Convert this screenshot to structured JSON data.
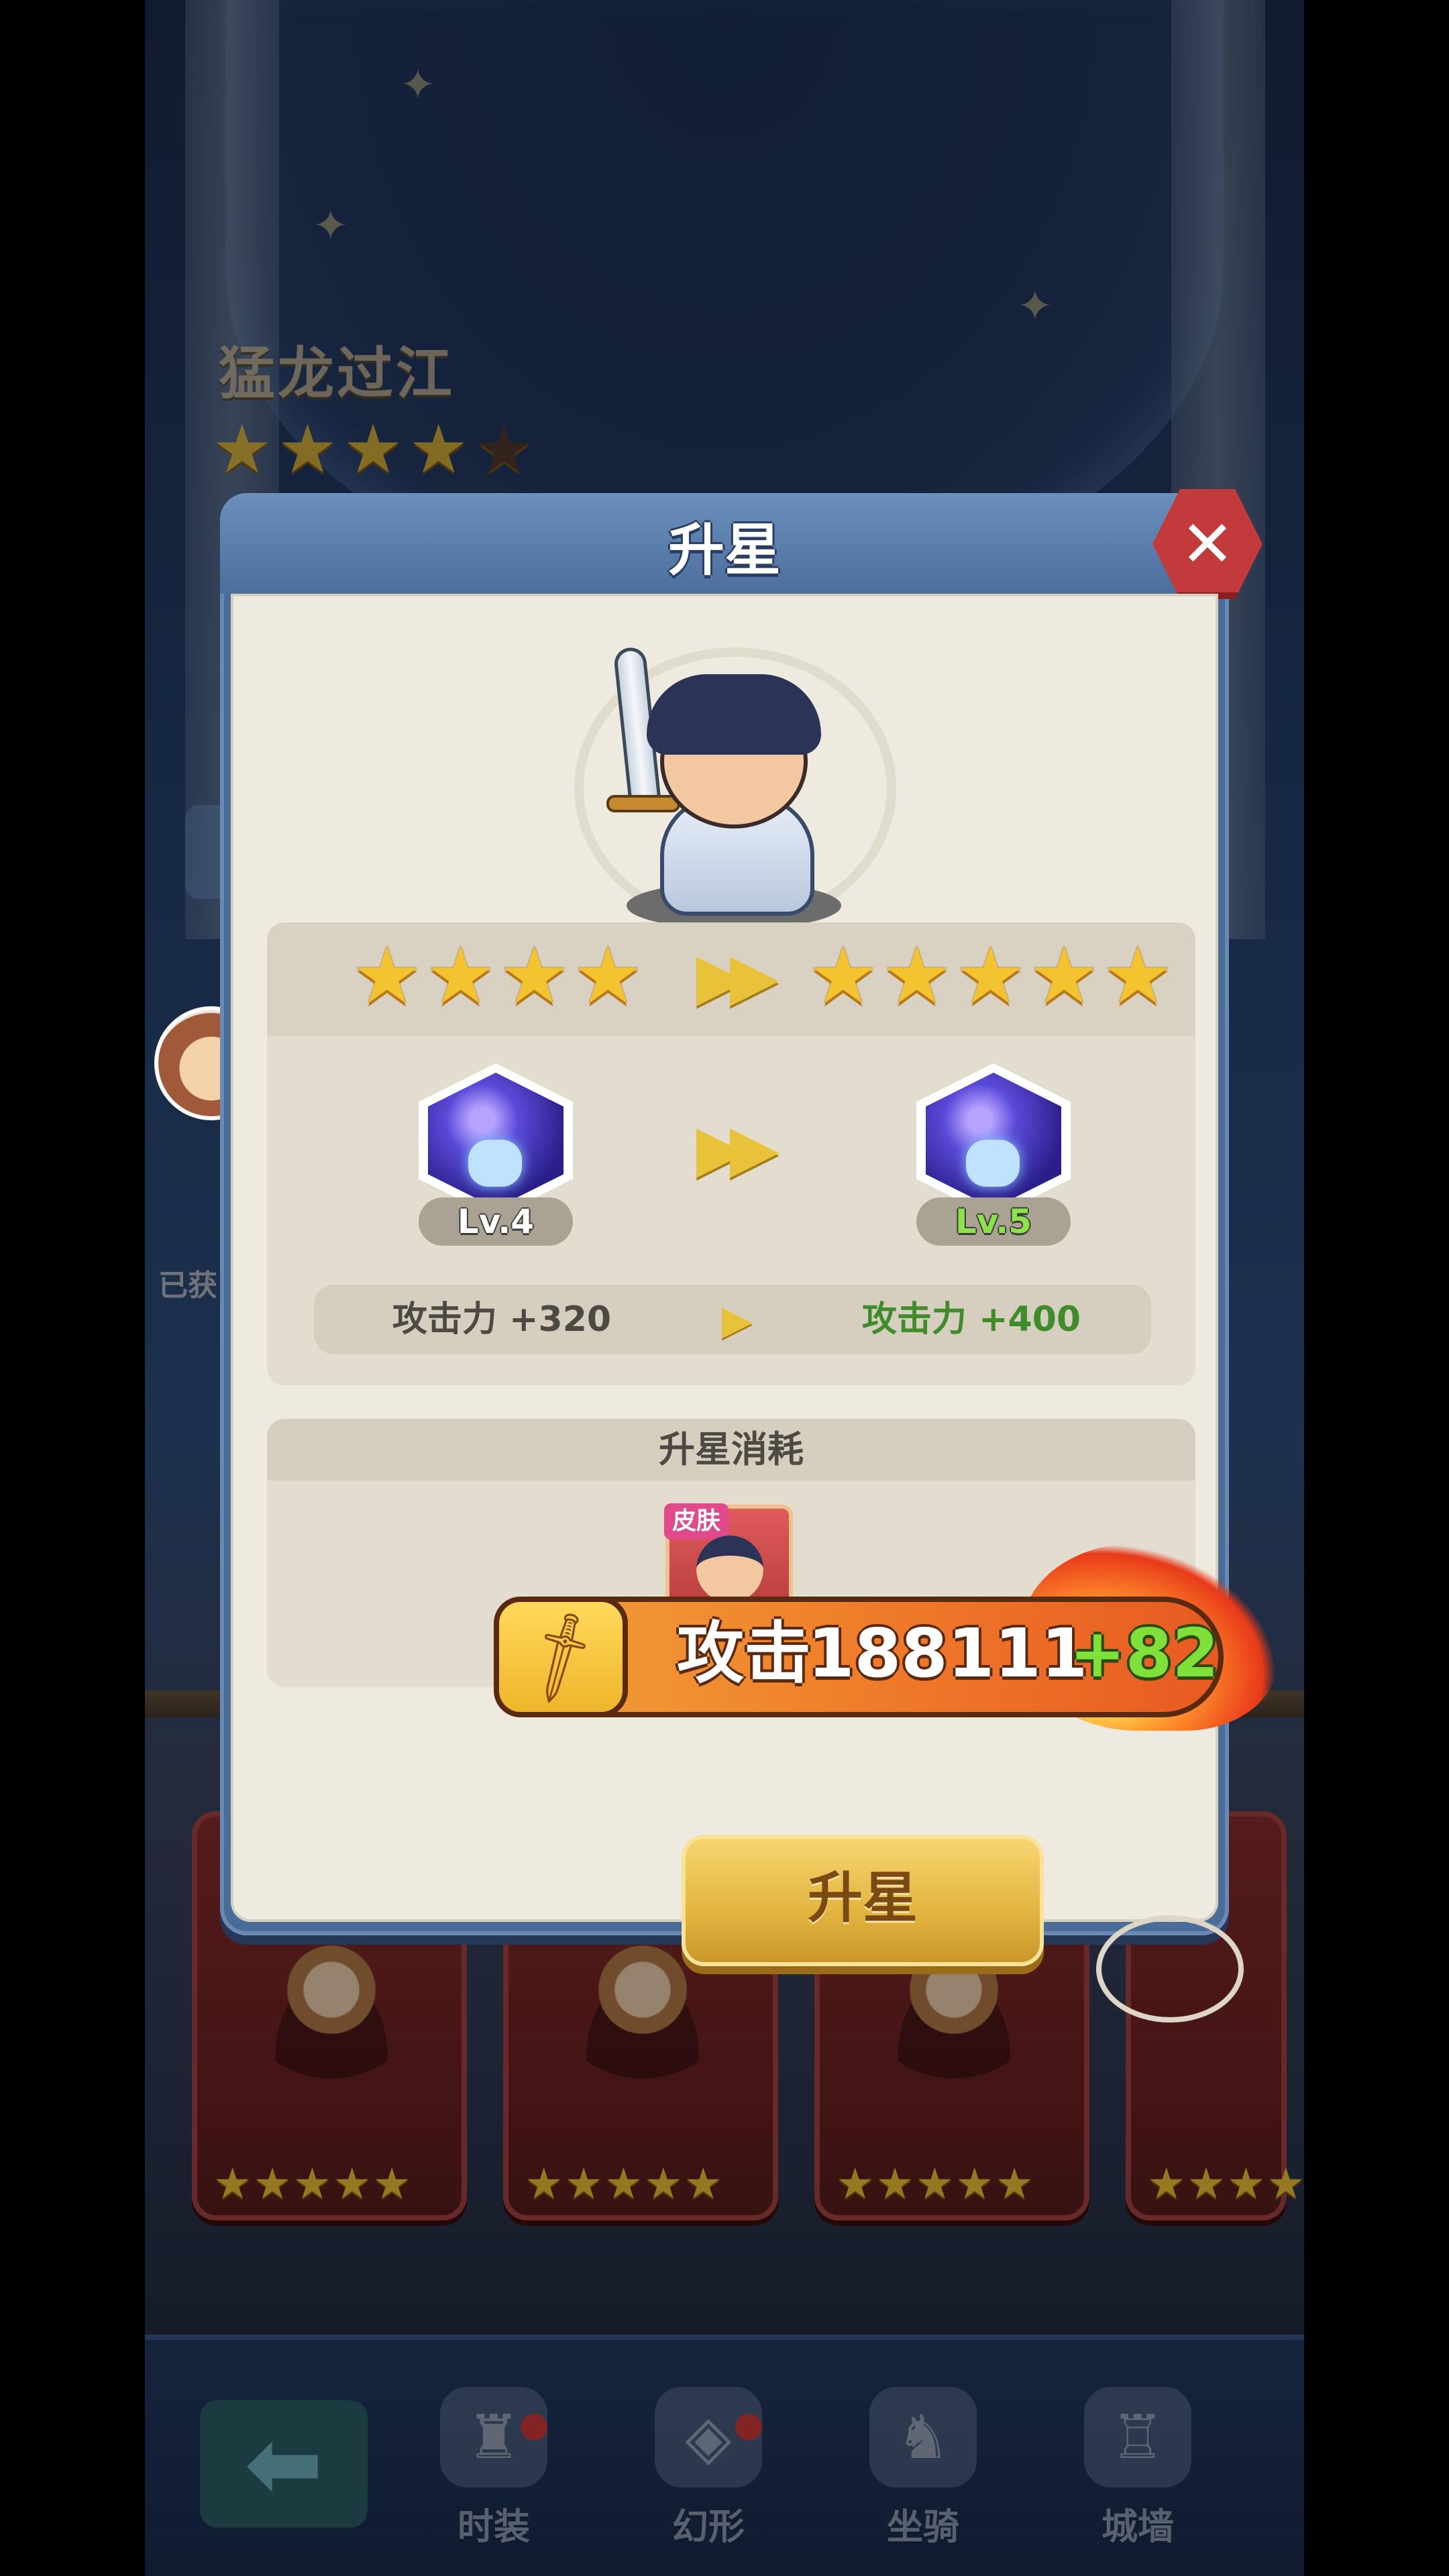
{
  "background": {
    "hero_name": "猛龙过江",
    "hero_stars": 4,
    "hero_stars_max": 5,
    "side_label": "已获",
    "card_stars": 5
  },
  "bottom_nav": {
    "items": [
      {
        "label": "时装",
        "icon": "costume-icon",
        "badge": true
      },
      {
        "label": "幻形",
        "icon": "transform-icon",
        "badge": true
      },
      {
        "label": "坐骑",
        "icon": "mount-icon",
        "badge": false
      },
      {
        "label": "城墙",
        "icon": "castle-wall-icon",
        "badge": false
      }
    ],
    "back_icon": "back-arrow-icon"
  },
  "dialog": {
    "title": "升星",
    "close_icon": "close-icon",
    "stars_current": 4,
    "stars_next": 5,
    "skill": {
      "current_level": "Lv.4",
      "next_level": "Lv.5",
      "icon": "fist-skill-icon"
    },
    "attribute": {
      "current": "攻击力 +320",
      "next": "攻击力 +400"
    },
    "cost": {
      "header": "升星消耗",
      "item_tag": "皮肤"
    },
    "confirm_label": "升星"
  },
  "power_toast": {
    "label": "攻击",
    "value": "188111",
    "delta": "+82"
  },
  "colors": {
    "gold": "#f4c430",
    "green": "#3f8c2b",
    "dialog_header": "#4c6e9c",
    "close_red": "#c23a3a"
  }
}
